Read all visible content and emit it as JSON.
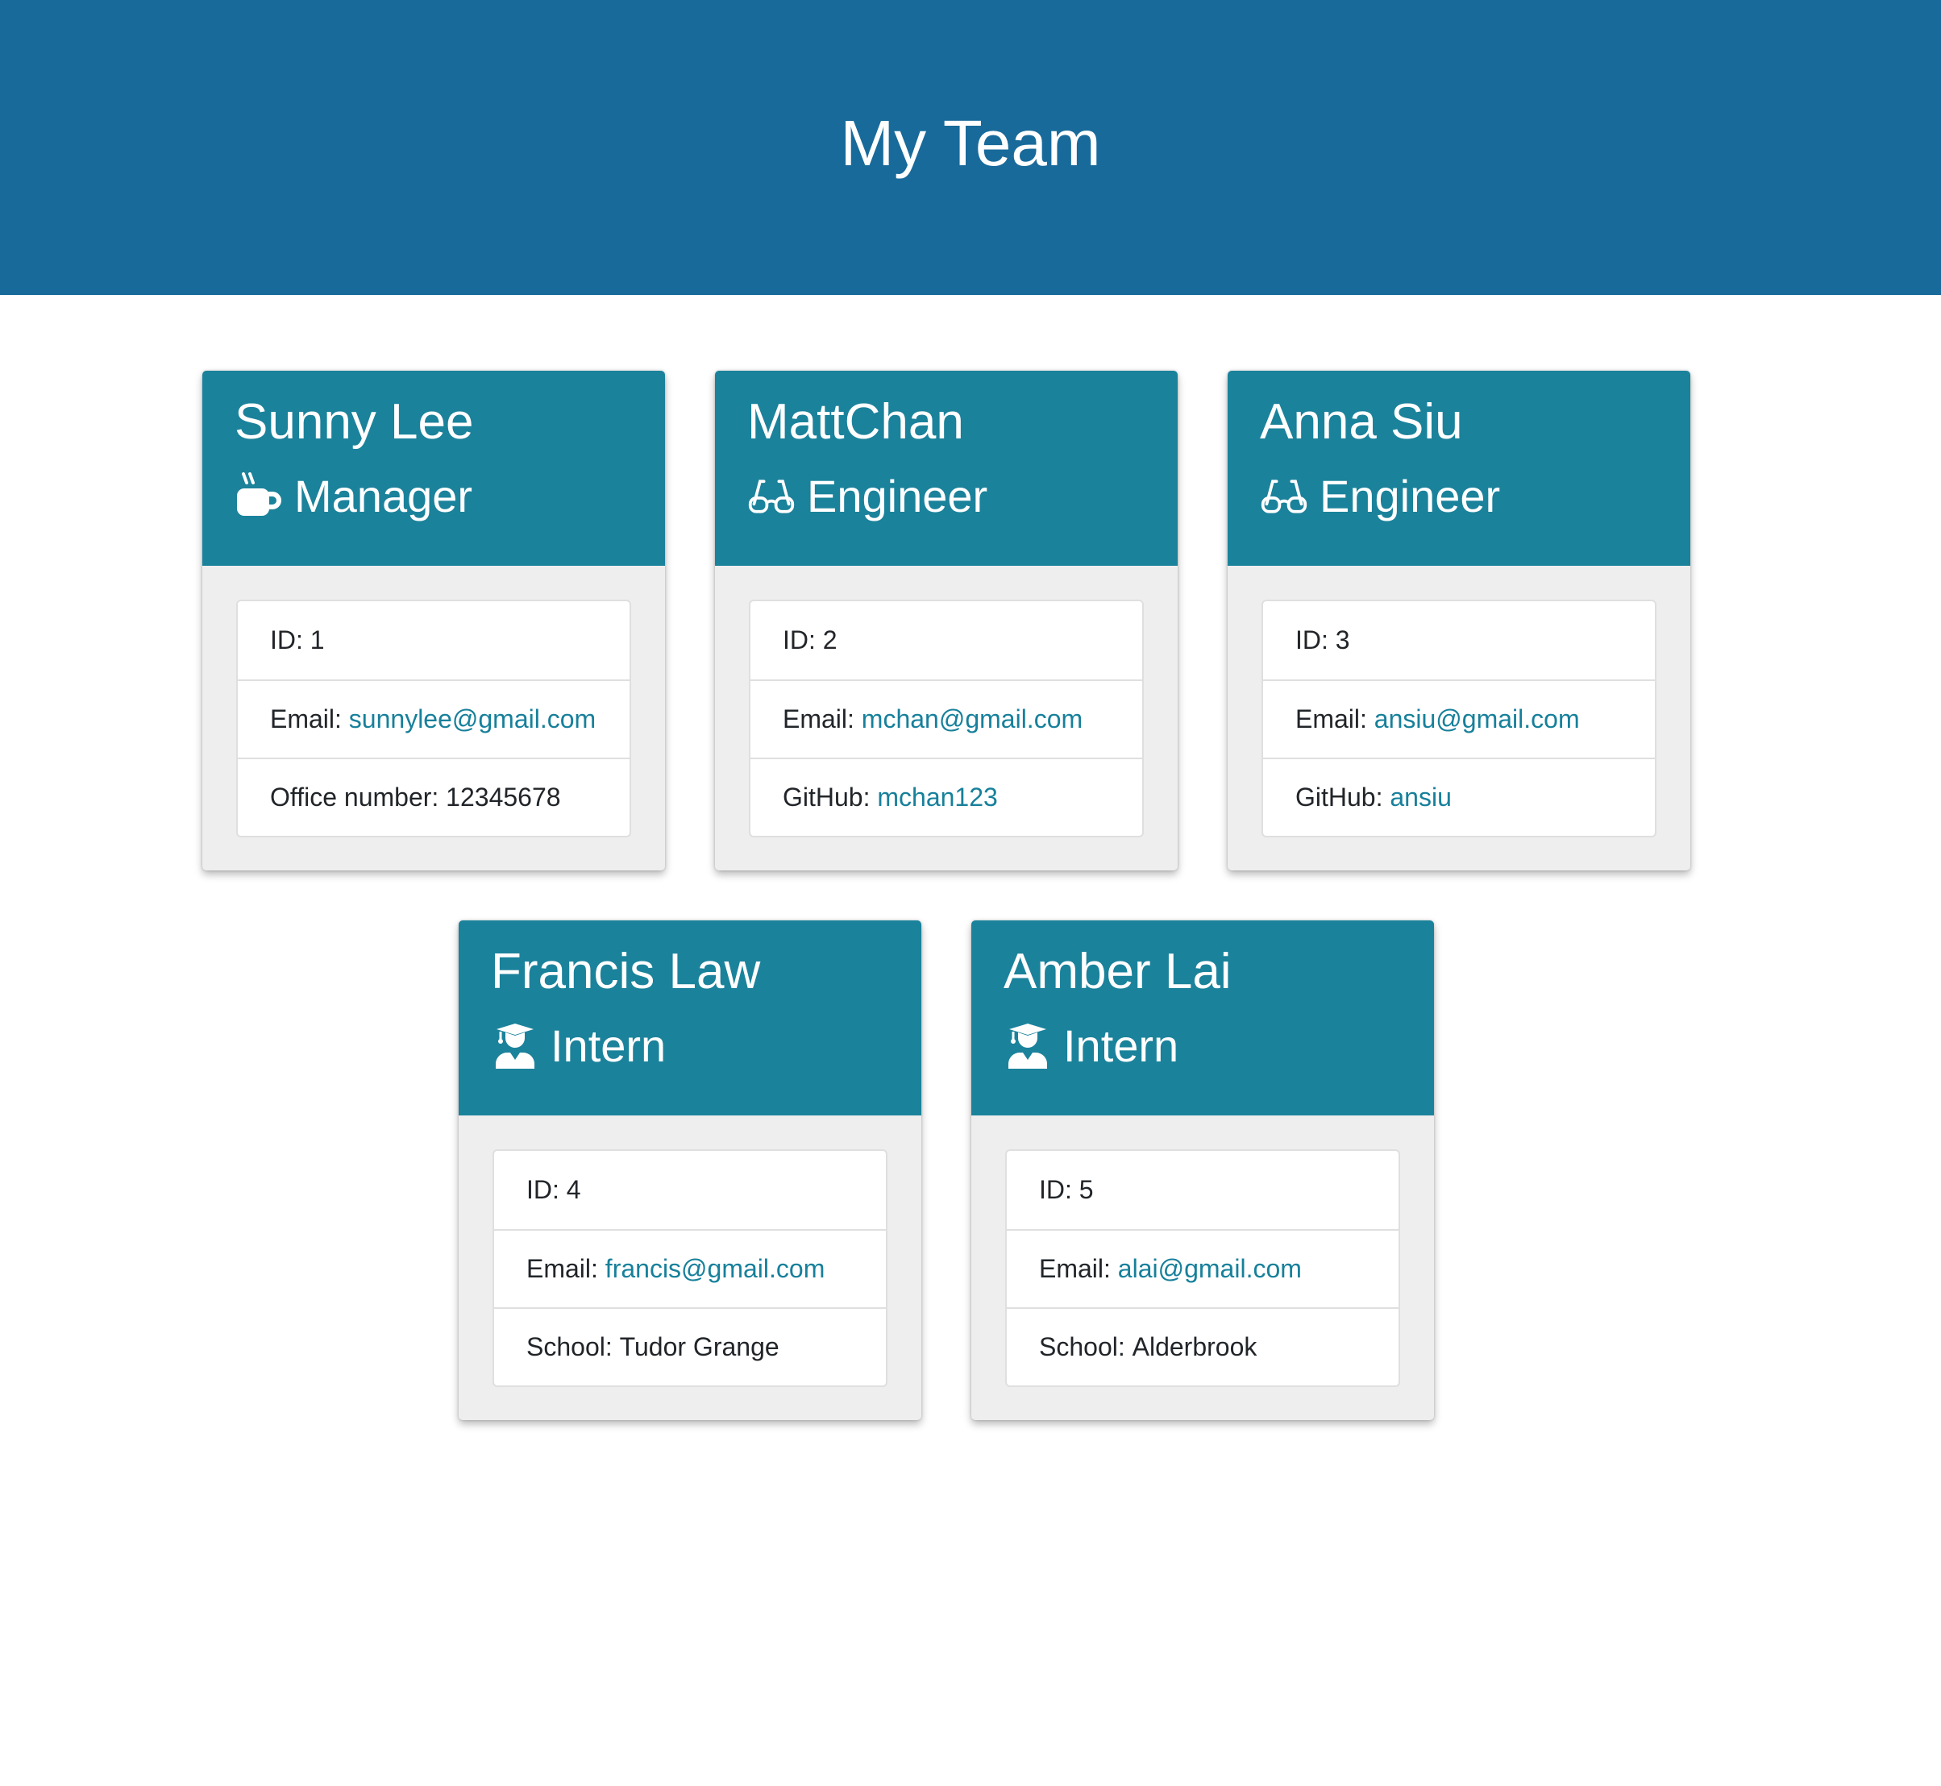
{
  "page": {
    "title": "My Team"
  },
  "colors": {
    "banner": "#186a9a",
    "card_header": "#1b829b",
    "link": "#17809b"
  },
  "employees": [
    {
      "name": "Sunny Lee",
      "role": "Manager",
      "icon": "coffee-icon",
      "id_label": "ID:",
      "id": "1",
      "email_label": "Email:",
      "email": "sunnylee@gmail.com",
      "extra_label": "Office number:",
      "extra_value": "12345678"
    },
    {
      "name": "MattChan",
      "role": "Engineer",
      "icon": "glasses-icon",
      "id_label": "ID:",
      "id": "2",
      "email_label": "Email:",
      "email": "mchan@gmail.com",
      "extra_label": "GitHub:",
      "extra_value": "mchan123"
    },
    {
      "name": "Anna Siu",
      "role": "Engineer",
      "icon": "glasses-icon",
      "id_label": "ID:",
      "id": "3",
      "email_label": "Email:",
      "email": "ansiu@gmail.com",
      "extra_label": "GitHub:",
      "extra_value": "ansiu"
    },
    {
      "name": "Francis Law",
      "role": "Intern",
      "icon": "graduate-icon",
      "id_label": "ID:",
      "id": "4",
      "email_label": "Email:",
      "email": "francis@gmail.com",
      "extra_label": "School:",
      "extra_value": "Tudor Grange"
    },
    {
      "name": "Amber Lai",
      "role": "Intern",
      "icon": "graduate-icon",
      "id_label": "ID:",
      "id": "5",
      "email_label": "Email:",
      "email": "alai@gmail.com",
      "extra_label": "School:",
      "extra_value": "Alderbrook"
    }
  ]
}
